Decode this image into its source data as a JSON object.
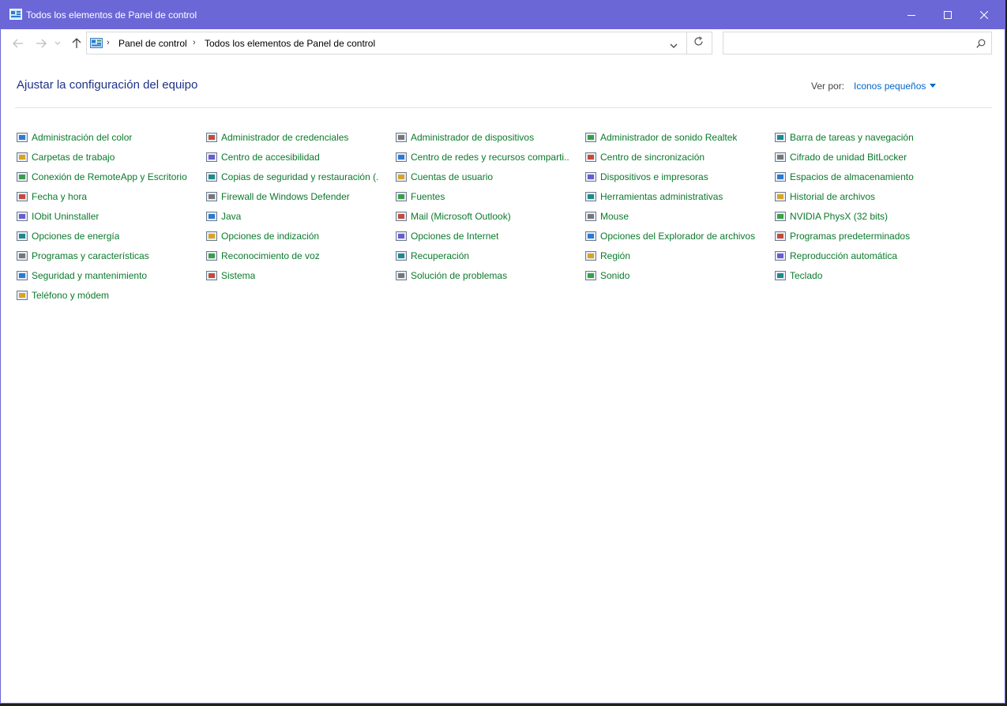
{
  "window": {
    "title": "Todos los elementos de Panel de control",
    "controls": {
      "minimize": "minimize-icon",
      "maximize": "maximize-icon",
      "close": "close-icon"
    }
  },
  "nav": {
    "breadcrumb": [
      "Panel de control",
      "Todos los elementos de Panel de control"
    ],
    "search": {
      "value": "",
      "placeholder": ""
    }
  },
  "header": {
    "title": "Ajustar la configuración del equipo",
    "view_by_label": "Ver por:",
    "view_by_value": "Iconos pequeños"
  },
  "colors": {
    "titlebar": "#6c67d6",
    "heading": "#1e3287",
    "link": "#0b7a2c",
    "view_by": "#0066cc"
  },
  "items": [
    [
      {
        "label": "Administración del color",
        "icon": "color-management-icon"
      },
      {
        "label": "Carpetas de trabajo",
        "icon": "work-folders-icon"
      },
      {
        "label": "Conexión de RemoteApp y Escritorio",
        "icon": "remoteapp-icon"
      },
      {
        "label": "Fecha y hora",
        "icon": "date-time-icon"
      },
      {
        "label": "IObit Uninstaller",
        "icon": "iobit-uninstaller-icon"
      },
      {
        "label": "Opciones de energía",
        "icon": "power-options-icon"
      },
      {
        "label": "Programas y características",
        "icon": "programs-features-icon"
      },
      {
        "label": "Seguridad y mantenimiento",
        "icon": "security-maintenance-flag-icon"
      },
      {
        "label": "Teléfono y módem",
        "icon": "phone-modem-icon"
      }
    ],
    [
      {
        "label": "Administrador de credenciales",
        "icon": "credential-manager-icon"
      },
      {
        "label": "Centro de accesibilidad",
        "icon": "ease-of-access-icon"
      },
      {
        "label": "Copias de seguridad y restauración (...",
        "icon": "backup-restore-icon"
      },
      {
        "label": "Firewall de Windows Defender",
        "icon": "firewall-icon"
      },
      {
        "label": "Java",
        "icon": "java-icon"
      },
      {
        "label": "Opciones de indización",
        "icon": "indexing-options-icon"
      },
      {
        "label": "Reconocimiento de voz",
        "icon": "microphone-icon"
      },
      {
        "label": "Sistema",
        "icon": "system-monitor-icon"
      }
    ],
    [
      {
        "label": "Administrador de dispositivos",
        "icon": "device-manager-icon"
      },
      {
        "label": "Centro de redes y recursos comparti...",
        "icon": "network-center-icon"
      },
      {
        "label": "Cuentas de usuario",
        "icon": "user-accounts-icon"
      },
      {
        "label": "Fuentes",
        "icon": "fonts-icon"
      },
      {
        "label": "Mail (Microsoft Outlook)",
        "icon": "mail-icon"
      },
      {
        "label": "Opciones de Internet",
        "icon": "internet-options-icon"
      },
      {
        "label": "Recuperación",
        "icon": "recovery-icon"
      },
      {
        "label": "Solución de problemas",
        "icon": "troubleshooting-icon"
      }
    ],
    [
      {
        "label": "Administrador de sonido Realtek",
        "icon": "realtek-audio-icon"
      },
      {
        "label": "Centro de sincronización",
        "icon": "sync-center-icon"
      },
      {
        "label": "Dispositivos e impresoras",
        "icon": "devices-printers-icon"
      },
      {
        "label": "Herramientas administrativas",
        "icon": "admin-tools-icon"
      },
      {
        "label": "Mouse",
        "icon": "mouse-icon"
      },
      {
        "label": "Opciones del Explorador de archivos",
        "icon": "folder-options-icon"
      },
      {
        "label": "Región",
        "icon": "region-globe-icon"
      },
      {
        "label": "Sonido",
        "icon": "speaker-icon"
      }
    ],
    [
      {
        "label": "Barra de tareas y navegación",
        "icon": "taskbar-icon"
      },
      {
        "label": "Cifrado de unidad BitLocker",
        "icon": "bitlocker-icon"
      },
      {
        "label": "Espacios de almacenamiento",
        "icon": "storage-spaces-icon"
      },
      {
        "label": "Historial de archivos",
        "icon": "file-history-icon"
      },
      {
        "label": "NVIDIA PhysX (32 bits)",
        "icon": "nvidia-physx-icon"
      },
      {
        "label": "Programas predeterminados",
        "icon": "default-programs-icon"
      },
      {
        "label": "Reproducción automática",
        "icon": "autoplay-icon"
      },
      {
        "label": "Teclado",
        "icon": "keyboard-icon"
      }
    ]
  ]
}
